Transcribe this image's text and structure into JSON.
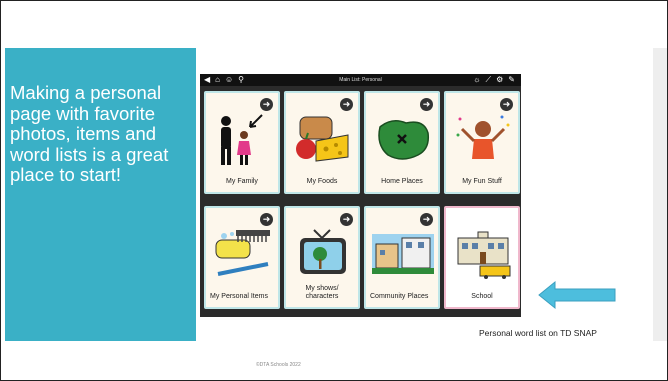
{
  "slide": {
    "text": "Making a personal page with favorite photos, items and word lists is a great place to start!",
    "caption": "Personal word list on TD SNAP",
    "footer": "©DTA Schools 2022"
  },
  "device": {
    "title": "Main List: Personal",
    "left_icons": [
      "back-icon",
      "home-icon",
      "people-icon",
      "search-icon"
    ],
    "right_icons": [
      "brightness-icon",
      "chart-icon",
      "settings-icon",
      "edit-icon"
    ]
  },
  "tiles": [
    {
      "label": "My Family",
      "icon": "family-icon"
    },
    {
      "label": "My Foods",
      "icon": "foods-icon"
    },
    {
      "label": "Home Places",
      "icon": "map-icon"
    },
    {
      "label": "My Fun Stuff",
      "icon": "fun-icon"
    },
    {
      "label": "My Personal Items",
      "icon": "personal-items-icon"
    },
    {
      "label": "My shows/ characters",
      "icon": "tv-icon"
    },
    {
      "label": "Community Places",
      "icon": "community-icon"
    },
    {
      "label": "School",
      "icon": "school-icon"
    }
  ],
  "colors": {
    "teal": "#3ab0c6",
    "arrow_blue": "#4dbedd",
    "tile_border": "#bfe6e8",
    "school_border": "#f0b8cc"
  }
}
